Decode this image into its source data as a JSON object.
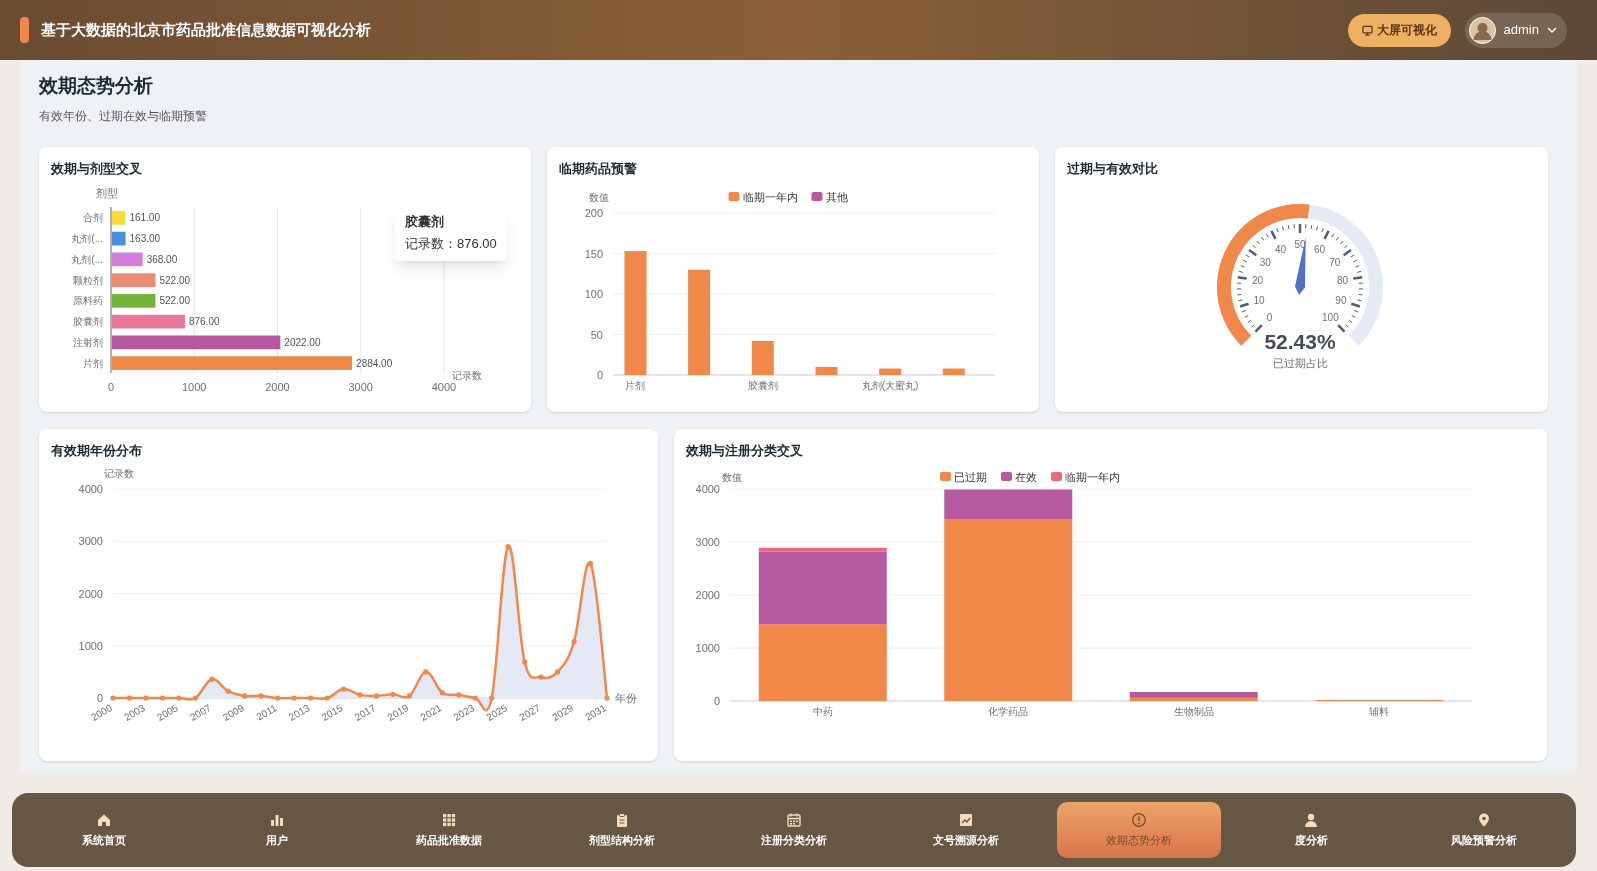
{
  "header": {
    "title": "基于大数据的北京市药品批准信息数据可视化分析",
    "screen_button": "大屏可视化",
    "user": "admin"
  },
  "page": {
    "title": "效期态势分析",
    "subtitle": "有效年份、过期在效与临期预警"
  },
  "cards": [
    {
      "title": "效期与剂型交叉",
      "chart_data": {
        "type": "bar",
        "orientation": "horizontal",
        "ylabel": "剂型",
        "categories": [
          "合剂",
          "丸剂(...",
          "丸剂(...",
          "颗粒剂",
          "原料药",
          "胶囊剂",
          "注射剂",
          "片剂"
        ],
        "series": [
          {
            "name": "记录数",
            "values": [
              161,
              163,
              368,
              522,
              522,
              876,
              2022,
              2884
            ]
          }
        ],
        "colors": [
          "#f9dc3c",
          "#4a8fdc",
          "#d17fd8",
          "#ec8c74",
          "#75b43c",
          "#ea7899",
          "#b5589e",
          "#f0884a"
        ],
        "value_labels": [
          "161.00",
          "163.00",
          "368.00",
          "522.00",
          "522.00",
          "876.00",
          "2022.00",
          "2884.00"
        ],
        "xlim": [
          0,
          4000
        ],
        "xticks": [
          0,
          1000,
          2000,
          3000,
          4000
        ],
        "grid": true
      },
      "tooltip": {
        "title": "胶囊剂",
        "separator": "：",
        "value": "876.00"
      }
    },
    {
      "title": "临期药品预警",
      "chart_data": {
        "type": "bar",
        "orientation": "vertical",
        "ylabel": "数值",
        "categories": [
          "片剂",
          null,
          "胶囊剂",
          null,
          "丸剂(大蜜丸)",
          null
        ],
        "series": [
          {
            "name": "临期一年内",
            "color": "#f0884a",
            "values": [
              153,
              130,
              42,
              10,
              8,
              8
            ]
          },
          {
            "name": "其他",
            "color": "#b55aa0",
            "values": [
              null,
              null,
              null,
              null,
              null,
              null
            ]
          }
        ],
        "ylim": [
          0,
          200
        ],
        "yticks": [
          0,
          50,
          100,
          150,
          200
        ],
        "grid": true,
        "legend": true
      }
    },
    {
      "title": "过期与有效对比",
      "gauge": {
        "level": 0.5243,
        "value_text": "52.43%",
        "label": "已过期占比",
        "ticks": [
          "0",
          "10",
          "20",
          "30",
          "40",
          "50",
          "60",
          "70",
          "80",
          "90",
          "100"
        ]
      }
    },
    {
      "title": "有效期年份分布",
      "chart_data": {
        "type": "area",
        "xlabel": "年份",
        "categories": [
          "2000",
          null,
          "2003",
          null,
          "2005",
          null,
          "2007",
          null,
          "2009",
          null,
          "2011",
          null,
          "2013",
          null,
          "2015",
          null,
          "2017",
          null,
          "2019",
          null,
          "2021",
          null,
          "2023",
          null,
          "2025",
          null,
          "2027",
          null,
          "2029",
          null,
          "2031"
        ],
        "series": [
          {
            "name": "记录数",
            "color": "#f0884a",
            "values": [
              0,
              0,
              0,
              0,
              0,
              0,
              360,
              130,
              40,
              40,
              0,
              0,
              0,
              0,
              170,
              60,
              40,
              70,
              40,
              500,
              100,
              60,
              0,
              0,
              2900,
              690,
              400,
              500,
              1080,
              2570,
              0
            ]
          }
        ],
        "ylim": [
          0,
          4000
        ],
        "yticks": [
          0,
          1000,
          2000,
          3000,
          4000
        ],
        "grid": true
      }
    },
    {
      "title": "效期与注册分类交叉",
      "chart_data": {
        "type": "bar",
        "orientation": "vertical",
        "stacked": true,
        "ylabel": "数值",
        "categories": [
          "中药",
          "化学药品",
          "生物制品",
          "辅料"
        ],
        "series": [
          {
            "name": "已过期",
            "color": "#f0884a",
            "values": [
              1450,
              3430,
              60,
              20
            ]
          },
          {
            "name": "在效",
            "color": "#b55aa0",
            "values": [
              1370,
              560,
              110,
              0
            ]
          },
          {
            "name": "临期一年内",
            "color": "#ee6680",
            "values": [
              70,
              0,
              0,
              0
            ]
          }
        ],
        "ylim": [
          0,
          4000
        ],
        "yticks": [
          0,
          1000,
          2000,
          3000,
          4000
        ],
        "grid": true,
        "legend": true
      }
    }
  ],
  "nav": [
    {
      "label": "系统首页",
      "selected": false
    },
    {
      "label": "用户",
      "selected": false
    },
    {
      "label": "药品批准数据",
      "selected": false
    },
    {
      "label": "剂型结构分析",
      "selected": false
    },
    {
      "label": "注册分类分析",
      "selected": false
    },
    {
      "label": "文号溯源分析",
      "selected": false
    },
    {
      "label": "效期态势分析",
      "selected": true
    },
    {
      "label": "度分析",
      "selected": false
    },
    {
      "label": "风险预警分析",
      "selected": false
    }
  ]
}
